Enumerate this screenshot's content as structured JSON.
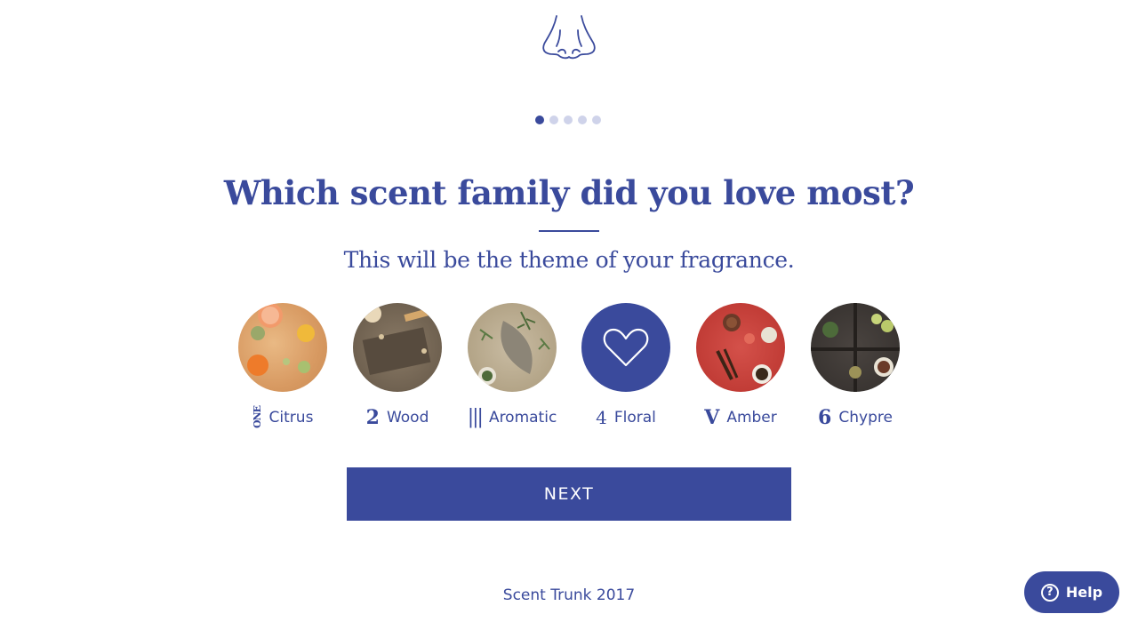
{
  "header": {
    "logo_icon": "nose-icon"
  },
  "progress": {
    "total_steps": 5,
    "current_step": 1
  },
  "question": {
    "title": "Which scent family did you love most?",
    "subtitle": "This will be the theme of your fragrance."
  },
  "options": [
    {
      "number": "ONE",
      "label": "Citrus",
      "selected": false
    },
    {
      "number": "2",
      "label": "Wood",
      "selected": false
    },
    {
      "number": "|||",
      "label": "Aromatic",
      "selected": false
    },
    {
      "number": "4",
      "label": "Floral",
      "selected": true,
      "icon": "heart-icon"
    },
    {
      "number": "V",
      "label": "Amber",
      "selected": false
    },
    {
      "number": "6",
      "label": "Chypre",
      "selected": false
    }
  ],
  "next_button": {
    "label": "NEXT"
  },
  "footer": {
    "text": "Scent Trunk 2017"
  },
  "help": {
    "label": "Help",
    "icon": "question-icon"
  },
  "colors": {
    "accent": "#3a4a9c",
    "inactive_dot": "#cfd3ea",
    "background": "#ffffff"
  }
}
